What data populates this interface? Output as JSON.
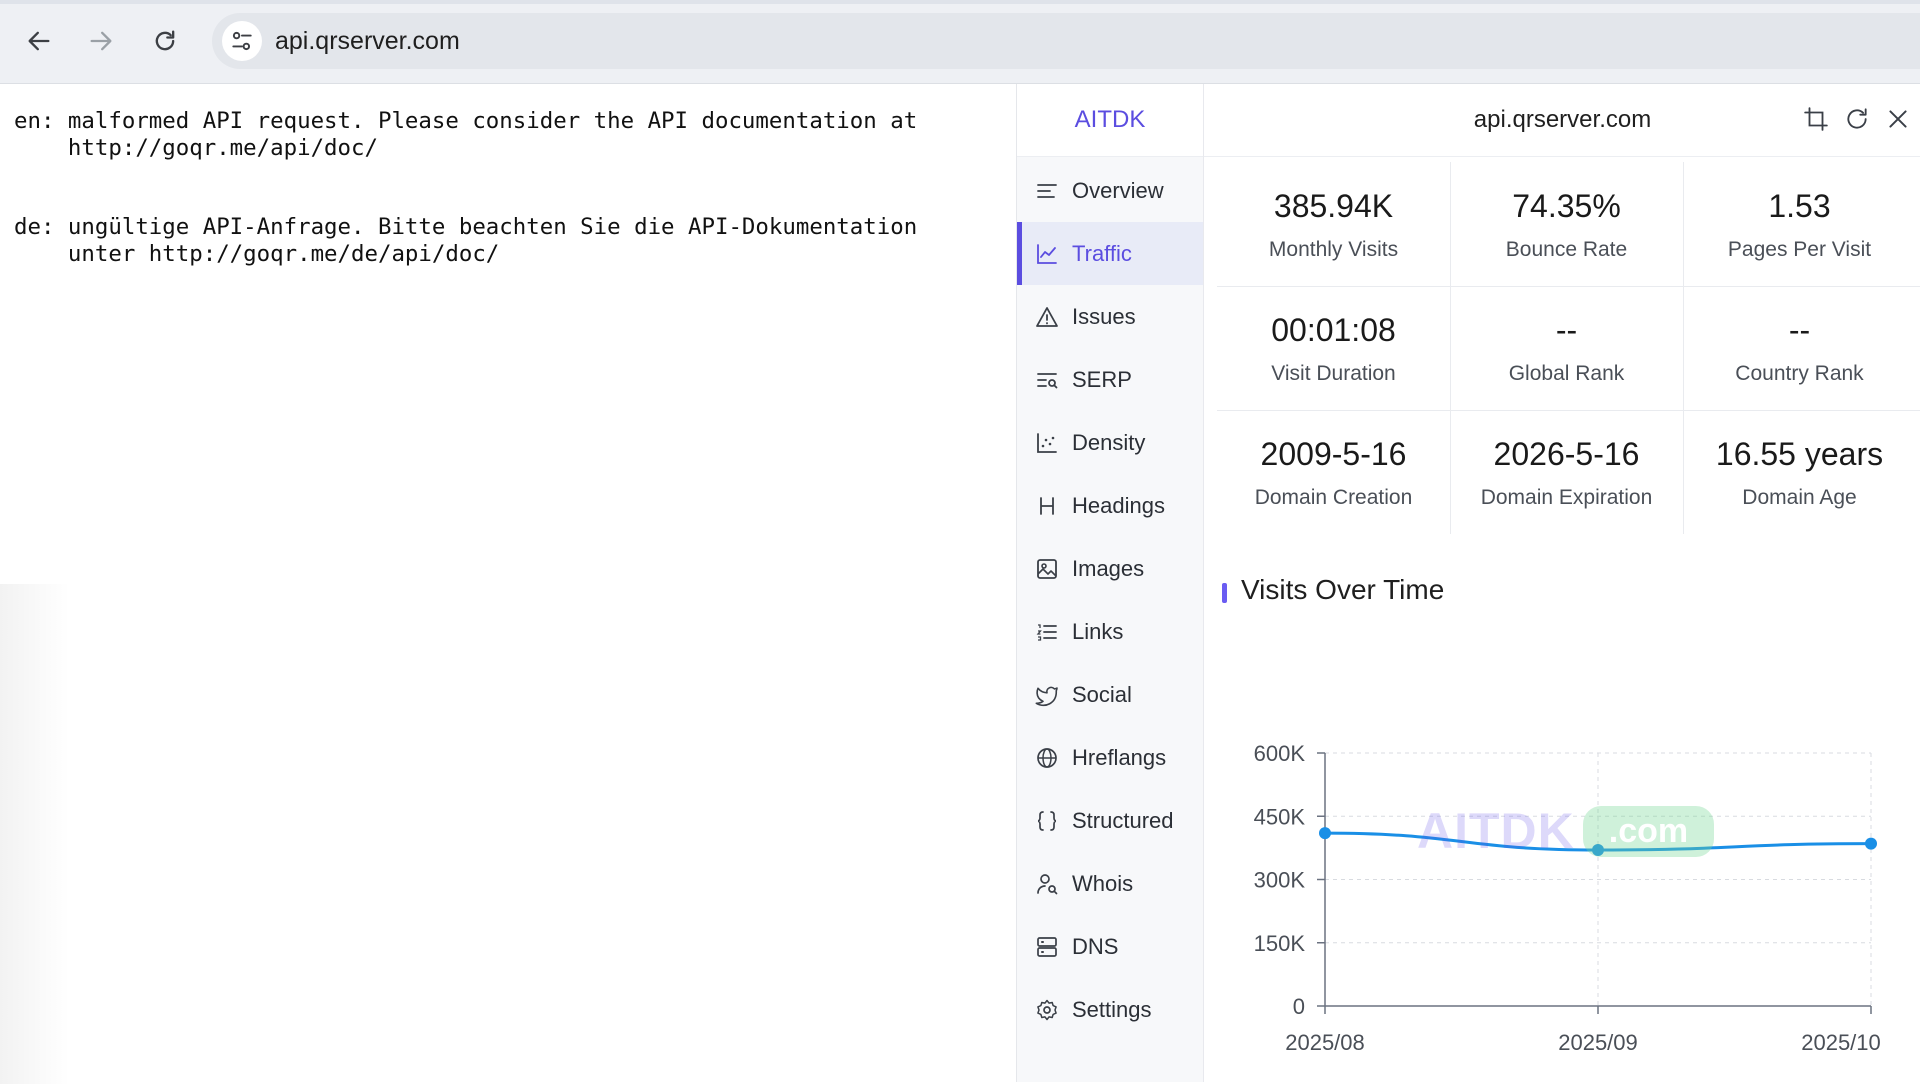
{
  "browser": {
    "url": "api.qrserver.com",
    "icons": {
      "back": "back-arrow-icon",
      "forward": "forward-arrow-icon",
      "reload": "reload-icon",
      "site_info": "tune-icon"
    }
  },
  "page": {
    "error_en": "en: malformed API request. Please consider the API documentation at\n    http://goqr.me/api/doc/",
    "error_de": "de: ungültige API-Anfrage. Bitte beachten Sie die API-Dokumentation\n    unter http://goqr.me/de/api/doc/"
  },
  "extension": {
    "brand": "AITDK",
    "site": "api.qrserver.com",
    "accent_color": "#5b4de0",
    "sidebar": [
      {
        "label": "Overview",
        "icon": "overview-icon",
        "active": false
      },
      {
        "label": "Traffic",
        "icon": "traffic-chart-icon",
        "active": true
      },
      {
        "label": "Issues",
        "icon": "warning-icon",
        "active": false
      },
      {
        "label": "SERP",
        "icon": "serp-icon",
        "active": false
      },
      {
        "label": "Density",
        "icon": "density-icon",
        "active": false
      },
      {
        "label": "Headings",
        "icon": "heading-icon",
        "active": false
      },
      {
        "label": "Images",
        "icon": "image-icon",
        "active": false
      },
      {
        "label": "Links",
        "icon": "links-icon",
        "active": false
      },
      {
        "label": "Social",
        "icon": "twitter-icon",
        "active": false
      },
      {
        "label": "Hreflangs",
        "icon": "globe-icon",
        "active": false
      },
      {
        "label": "Structured",
        "icon": "braces-icon",
        "active": false
      },
      {
        "label": "Whois",
        "icon": "user-search-icon",
        "active": false
      },
      {
        "label": "DNS",
        "icon": "server-icon",
        "active": false
      },
      {
        "label": "Settings",
        "icon": "gear-icon",
        "active": false
      }
    ],
    "header_icons": [
      "crop-icon",
      "refresh-icon",
      "close-icon"
    ],
    "stats": [
      {
        "value": "385.94K",
        "label": "Monthly Visits"
      },
      {
        "value": "74.35%",
        "label": "Bounce Rate"
      },
      {
        "value": "1.53",
        "label": "Pages Per Visit"
      },
      {
        "value": "00:01:08",
        "label": "Visit Duration"
      },
      {
        "value": "--",
        "label": "Global Rank"
      },
      {
        "value": "--",
        "label": "Country Rank"
      },
      {
        "value": "2009-5-16",
        "label": "Domain Creation"
      },
      {
        "value": "2026-5-16",
        "label": "Domain Expiration"
      },
      {
        "value": "16.55 years",
        "label": "Domain Age"
      }
    ],
    "chart_title": "Visits Over Time",
    "watermark": {
      "brand": "AITDK",
      "tld": ".com"
    }
  },
  "chart_data": {
    "type": "line",
    "title": "Visits Over Time",
    "categories": [
      "2025/08",
      "2025/09",
      "2025/10"
    ],
    "series": [
      {
        "values": [
          410000,
          370000,
          385000
        ],
        "color": "#1a8fe6"
      }
    ],
    "yticks": [
      "0",
      "150K",
      "300K",
      "450K",
      "600K"
    ],
    "ytick_values": [
      0,
      150000,
      300000,
      450000,
      600000
    ],
    "ylim": [
      0,
      600000
    ],
    "grid": true
  }
}
